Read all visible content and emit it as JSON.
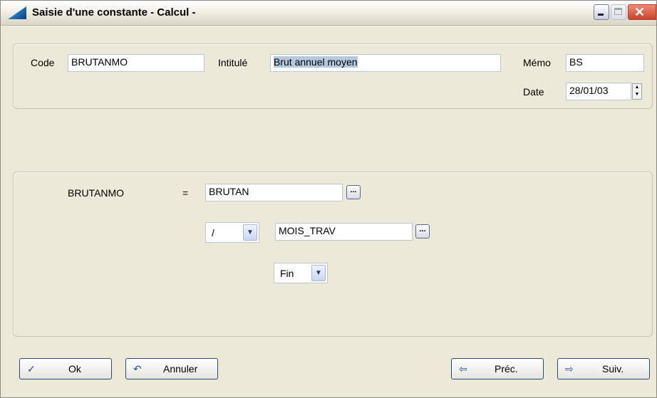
{
  "window": {
    "title": "Saisie d'une constante - Calcul -"
  },
  "header": {
    "code_label": "Code",
    "code_value": "BRUTANMO",
    "intitule_label": "Intitulé",
    "intitule_value": "Brut annuel moyen",
    "memo_label": "Mémo",
    "memo_value": "BS",
    "date_label": "Date",
    "date_value": "28/01/03"
  },
  "formula": {
    "result_name": "BRUTANMO",
    "equals": "=",
    "operand1": "BRUTAN",
    "operator": "/",
    "operand2": "MOIS_TRAV",
    "end_value": "Fin",
    "ellipsis": "..."
  },
  "buttons": {
    "ok": "Ok",
    "annuler": "Annuler",
    "prec": "Préc.",
    "suiv": "Suiv."
  },
  "colors": {
    "window_bg": "#ece9d8",
    "selection": "#b4c8e0",
    "button_border": "#2b4a7a"
  }
}
